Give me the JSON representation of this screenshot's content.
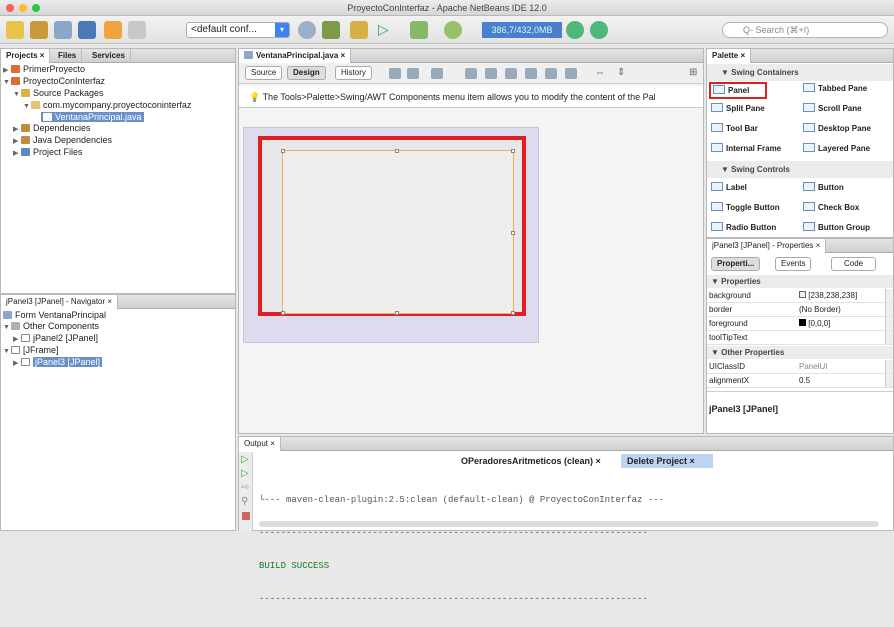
{
  "window": {
    "title": "ProyectoConInterfaz - Apache NetBeans IDE 12.0"
  },
  "toolbar": {
    "config": "<default conf...",
    "memory": "386,7/432,0MB",
    "search_placeholder": "Q‑ Search (⌘+I)"
  },
  "projects": {
    "tabs": [
      "Projects",
      "Files",
      "Services"
    ],
    "items": [
      {
        "label": "PrimerProyecto"
      },
      {
        "label": "ProyectoConInterfaz"
      },
      {
        "label": "Source Packages"
      },
      {
        "label": "com.mycompany.proyectoconinterfaz"
      },
      {
        "label": "VentanaPrincipal.java"
      },
      {
        "label": "Dependencies"
      },
      {
        "label": "Java Dependencies"
      },
      {
        "label": "Project Files"
      }
    ]
  },
  "navigator": {
    "title": "jPanel3 [JPanel] - Navigator",
    "items": [
      {
        "label": "Form VentanaPrincipal"
      },
      {
        "label": "Other Components"
      },
      {
        "label": "jPanel2 [JPanel]"
      },
      {
        "label": "[JFrame]"
      },
      {
        "label": "jPanel3 [JPanel]"
      }
    ]
  },
  "editor": {
    "tab": "VentanaPrincipal.java",
    "buttons": [
      "Source",
      "Design",
      "History"
    ],
    "hint": "The Tools>Palette>Swing/AWT Components menu item allows you to modify the content of the Pal"
  },
  "palette": {
    "title": "Palette",
    "cat_containers": "Swing Containers",
    "containers": [
      "Panel",
      "Tabbed Pane",
      "Split Pane",
      "Scroll Pane",
      "Tool Bar",
      "Desktop Pane",
      "Internal Frame",
      "Layered Pane"
    ],
    "cat_controls": "Swing Controls",
    "controls": [
      "Label",
      "Button",
      "Toggle Button",
      "Check Box",
      "Radio Button",
      "Button Group"
    ]
  },
  "properties": {
    "title": "jPanel3 [JPanel] - Properties",
    "tabs": [
      "Properti...",
      "Events",
      "Code"
    ],
    "section1": "Properties",
    "rows1": [
      {
        "k": "background",
        "v": "[238,238,238]"
      },
      {
        "k": "border",
        "v": "(No Border)"
      },
      {
        "k": "foreground",
        "v": "[0,0,0]"
      },
      {
        "k": "toolTipText",
        "v": ""
      }
    ],
    "section2": "Other Properties",
    "rows2": [
      {
        "k": "UIClassID",
        "v": "PanelUI"
      },
      {
        "k": "alignmentX",
        "v": "0.5"
      }
    ],
    "footer": "jPanel3 [JPanel]"
  },
  "output": {
    "tab": "Output",
    "subtabs": [
      "OPeradoresAritmeticos (clean)",
      "Delete Project"
    ],
    "line1": "└--- maven-clean-plugin:2.5:clean (default-clean) @ ProyectoConInterfaz ---",
    "sep": "------------------------------------------------------------------------",
    "line2": "BUILD SUCCESS"
  },
  "colors": {
    "highlight": "#e02020",
    "selection": "#6b8fc9",
    "accent": "#3b82f6"
  }
}
